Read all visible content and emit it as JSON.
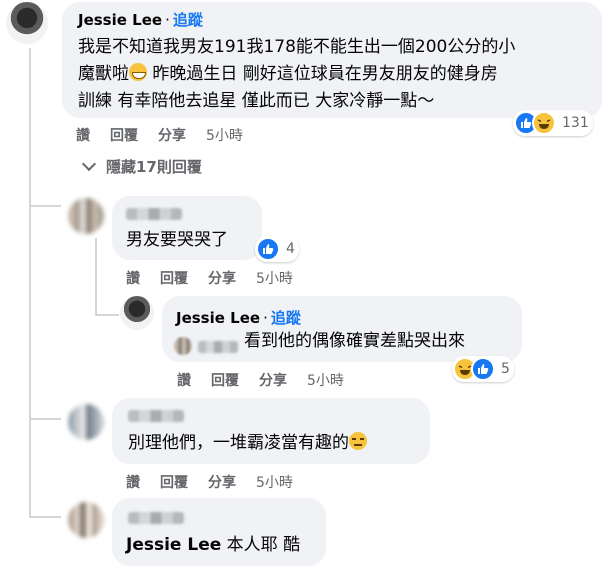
{
  "top_comment": {
    "author": "Jessie Lee",
    "follow": "追蹤",
    "text_line1": "我是不知道我男友191我178能不能生出一個200公分的小",
    "text_line2a": "魔獸啦",
    "text_line2b": " 昨晚過生日 剛好這位球員在男友朋友的健身房",
    "text_line3": "訓練 有幸陪他去追星 僅此而已 大家冷靜一點～",
    "reaction_count": "131",
    "actions": {
      "like": "讚",
      "reply": "回覆",
      "share": "分享",
      "time": "5小時"
    }
  },
  "hidden_replies": {
    "label": "隱藏17則回覆"
  },
  "reply1": {
    "text": "男友要哭哭了",
    "reaction_count": "4",
    "actions": {
      "like": "讚",
      "reply": "回覆",
      "share": "分享",
      "time": "5小時"
    }
  },
  "reply1_sub": {
    "author": "Jessie Lee",
    "follow": "追蹤",
    "text": "看到他的偶像確實差點哭出來",
    "reaction_count": "5",
    "actions": {
      "like": "讚",
      "reply": "回覆",
      "share": "分享",
      "time": "5小時"
    }
  },
  "reply2": {
    "text": "別理他們，一堆霸凌當有趣的",
    "actions": {
      "like": "讚",
      "reply": "回覆",
      "share": "分享",
      "time": "5小時"
    }
  },
  "reply3": {
    "mention": "Jessie Lee",
    "text": " 本人耶 酷"
  },
  "icons": [
    "like-icon",
    "haha-icon",
    "grin-emoji",
    "unamused-emoji",
    "chevron-down-icon"
  ],
  "colors": {
    "link_blue": "#1877f2",
    "bubble_gray": "#f0f2f5",
    "meta_gray": "#65676b"
  }
}
